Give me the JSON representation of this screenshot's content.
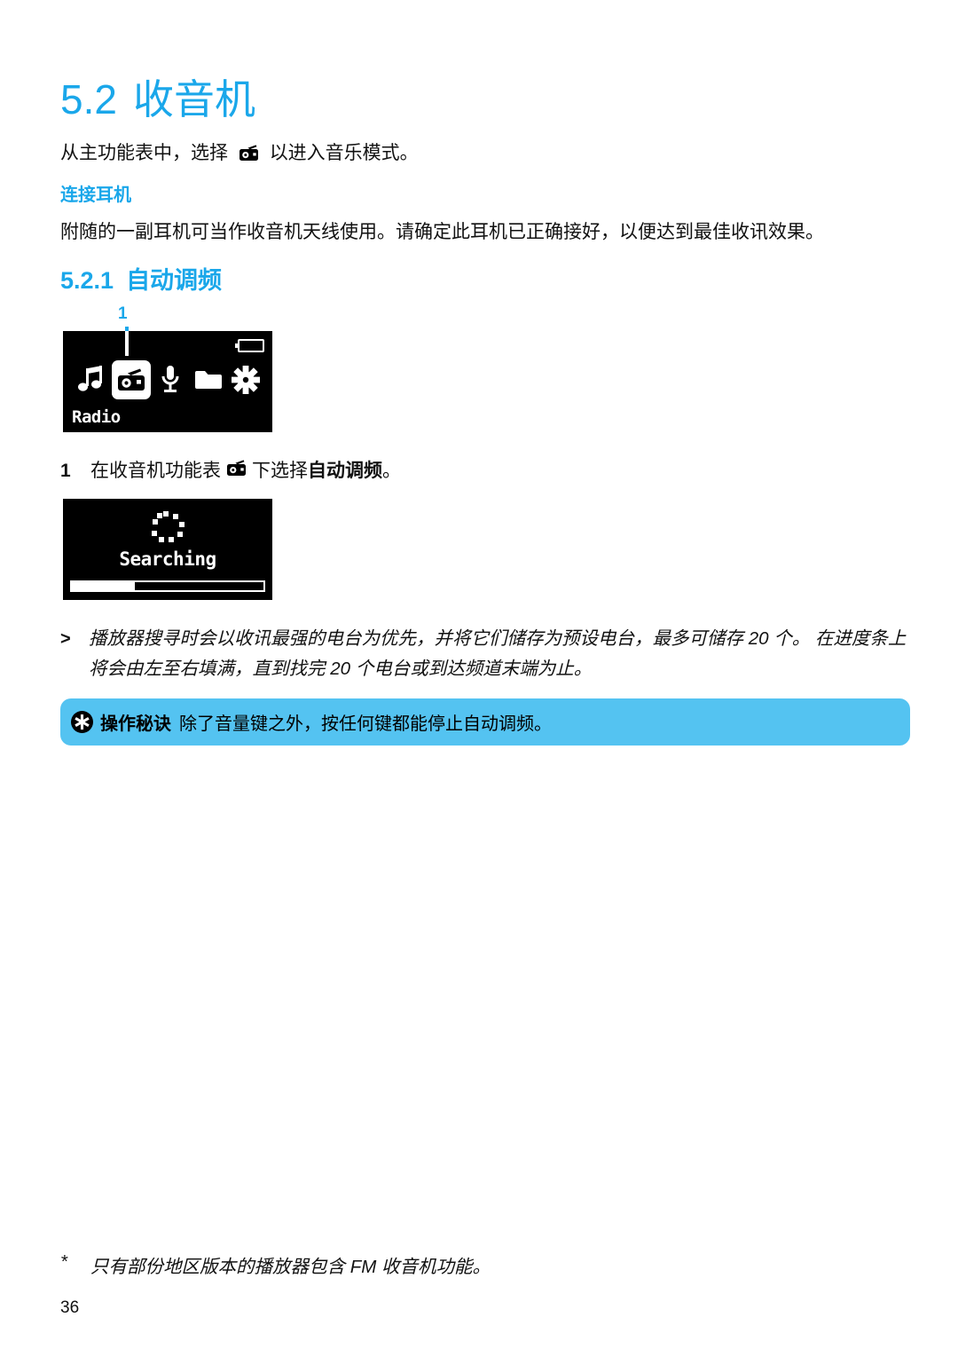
{
  "document": {
    "page_number": "36",
    "accent_color": "#1AA7EA",
    "tip_bg_color": "#54C3F1"
  },
  "headings": {
    "h1_number": "5.2",
    "h1_title": "收音机",
    "h2_number": "5.2.1",
    "h2_title": "自动调频",
    "h3_title": "连接耳机"
  },
  "body": {
    "intro_before_icon": "从主功能表中，选择",
    "intro_after_icon": "以进入音乐模式。",
    "headphone_paragraph": "附随的一副耳机可当作收音机天线使用。请确定此耳机已正确接好，以便达到最佳收讯效果。"
  },
  "callouts": {
    "label_1": "1"
  },
  "screen_menu": {
    "battery_icon": "battery-icon",
    "icons": [
      {
        "name": "music-note-icon",
        "selected": false
      },
      {
        "name": "radio-icon",
        "selected": true
      },
      {
        "name": "microphone-icon",
        "selected": false
      },
      {
        "name": "folder-icon",
        "selected": false
      },
      {
        "name": "settings-gear-icon",
        "selected": false
      }
    ],
    "label": "Radio"
  },
  "screen_search": {
    "spinner_icon": "loading-spinner-icon",
    "status_text": "Searching",
    "progress_percent": 33
  },
  "steps": [
    {
      "number": "1",
      "text_before_icon": "在收音机功能表",
      "icon": "radio-icon",
      "text_after_icon": "下选择",
      "bold_text": "自动调频",
      "text_end": "。"
    }
  ],
  "note": {
    "marker": ">",
    "line1": "播放器搜寻时会以收讯最强的电台为优先，并将它们储存为预设电台，最多可储存 20 个。",
    "line2": "在进度条上将会由左至右填满，直到找完 20 个电台或到达频道末端为止。"
  },
  "tip": {
    "icon": "asterisk-tip-icon",
    "label": "操作秘诀",
    "text": "除了音量键之外，按任何键都能停止自动调频。"
  },
  "footnote": {
    "marker": "*",
    "text": "只有部份地区版本的播放器包含 FM 收音机功能。"
  }
}
